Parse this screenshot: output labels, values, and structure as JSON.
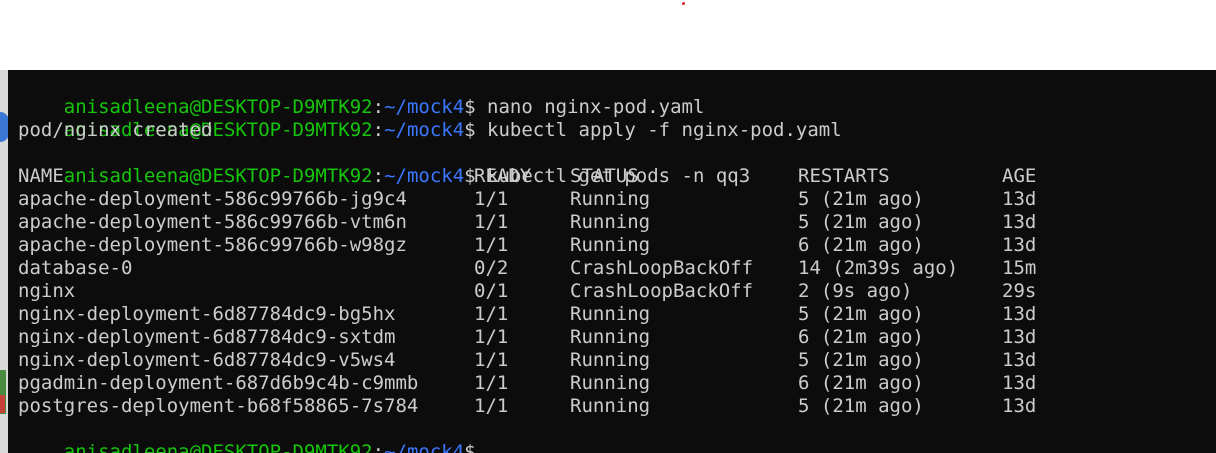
{
  "prompt": {
    "user_host": "anisadleena@DESKTOP-D9MTK92",
    "colon": ":",
    "path": "~/mock4",
    "dollar": "$"
  },
  "commands": [
    " nano nginx-pod.yaml",
    " kubectl apply -f nginx-pod.yaml",
    " kubectl get pods -n qq3"
  ],
  "apply_output": "pod/nginx created",
  "table": {
    "headers": [
      "NAME",
      "READY",
      "STATUS",
      "RESTARTS",
      "AGE"
    ],
    "rows": [
      [
        "apache-deployment-586c99766b-jg9c4",
        "1/1",
        "Running",
        "5 (21m ago)",
        "13d"
      ],
      [
        "apache-deployment-586c99766b-vtm6n",
        "1/1",
        "Running",
        "5 (21m ago)",
        "13d"
      ],
      [
        "apache-deployment-586c99766b-w98gz",
        "1/1",
        "Running",
        "6 (21m ago)",
        "13d"
      ],
      [
        "database-0",
        "0/2",
        "CrashLoopBackOff",
        "14 (2m39s ago)",
        "15m"
      ],
      [
        "nginx",
        "0/1",
        "CrashLoopBackOff",
        "2 (9s ago)",
        "29s"
      ],
      [
        "nginx-deployment-6d87784dc9-bg5hx",
        "1/1",
        "Running",
        "5 (21m ago)",
        "13d"
      ],
      [
        "nginx-deployment-6d87784dc9-sxtdm",
        "1/1",
        "Running",
        "6 (21m ago)",
        "13d"
      ],
      [
        "nginx-deployment-6d87784dc9-v5ws4",
        "1/1",
        "Running",
        "5 (21m ago)",
        "13d"
      ],
      [
        "pgadmin-deployment-687d6b9c4b-c9mmb",
        "1/1",
        "Running",
        "6 (21m ago)",
        "13d"
      ],
      [
        "postgres-deployment-b68f58865-7s784",
        "1/1",
        "Running",
        "5 (21m ago)",
        "13d"
      ]
    ]
  },
  "colors": {
    "terminal_bg": "#0c0c0c",
    "prompt_user": "#16c60c",
    "prompt_path": "#3b78ff",
    "text": "#cccccc"
  }
}
